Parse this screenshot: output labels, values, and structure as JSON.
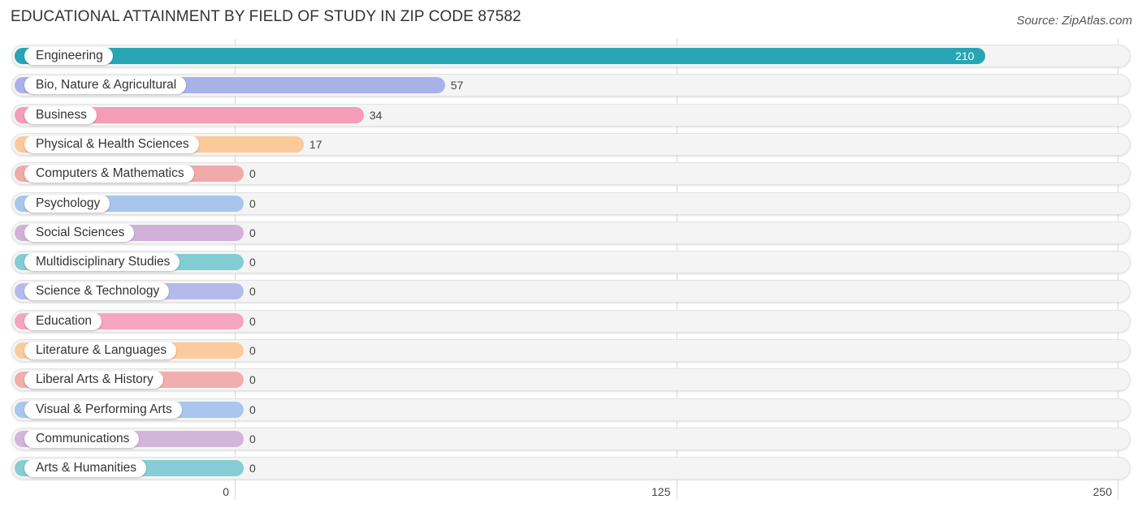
{
  "header": {
    "title": "EDUCATIONAL ATTAINMENT BY FIELD OF STUDY IN ZIP CODE 87582",
    "source": "Source: ZipAtlas.com"
  },
  "chart_data": {
    "type": "bar",
    "orientation": "horizontal",
    "title": "EDUCATIONAL ATTAINMENT BY FIELD OF STUDY IN ZIP CODE 87582",
    "xlabel": "",
    "ylabel": "",
    "xlim": [
      0,
      250
    ],
    "xticks": [
      0,
      125,
      250
    ],
    "xtick_labels": [
      "0",
      "125",
      "250"
    ],
    "grid": true,
    "categories": [
      "Engineering",
      "Bio, Nature & Agricultural",
      "Business",
      "Physical & Health Sciences",
      "Computers & Mathematics",
      "Psychology",
      "Social Sciences",
      "Multidisciplinary Studies",
      "Science & Technology",
      "Education",
      "Literature & Languages",
      "Liberal Arts & History",
      "Visual & Performing Arts",
      "Communications",
      "Arts & Humanities"
    ],
    "values": [
      210,
      57,
      34,
      17,
      0,
      0,
      0,
      0,
      0,
      0,
      0,
      0,
      0,
      0,
      0
    ],
    "value_labels": [
      "210",
      "57",
      "34",
      "17",
      "0",
      "0",
      "0",
      "0",
      "0",
      "0",
      "0",
      "0",
      "0",
      "0",
      "0"
    ],
    "colors": [
      "#27a5b5",
      "#a9b2e8",
      "#f49cb8",
      "#fbc99a",
      "#f0aaaa",
      "#a8c6ec",
      "#d0b2d8",
      "#82ccd4",
      "#b4bbea",
      "#f6a5c0",
      "#fbcb9e",
      "#f0aeac",
      "#a9c7ec",
      "#d3b4da",
      "#86cdd5"
    ]
  }
}
